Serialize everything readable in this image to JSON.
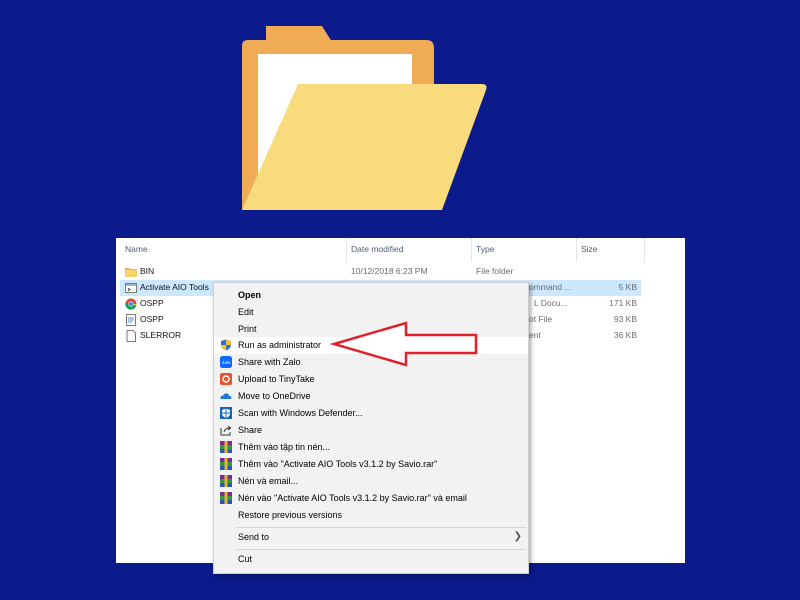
{
  "explorer": {
    "columns": {
      "name": "Name",
      "date": "Date modified",
      "type": "Type",
      "size": "Size"
    },
    "rows": [
      {
        "name": "BIN",
        "date": "10/12/2018 6:23 PM",
        "type": "File folder",
        "size": "",
        "icon": "folder-icon"
      },
      {
        "name": "Activate AIO Tools",
        "type_partial": "ommand ...",
        "size": "5 KB",
        "icon": "cmd-file-icon"
      },
      {
        "name": "OSPP",
        "type_partial": "L Docu...",
        "size": "171 KB",
        "icon": "chrome-icon"
      },
      {
        "name": "OSPP",
        "type_partial": "ot File",
        "size": "93 KB",
        "icon": "script-file-icon"
      },
      {
        "name": "SLERROR",
        "type_partial": "ent",
        "size": "36 KB",
        "icon": "document-icon"
      }
    ]
  },
  "context_menu": {
    "items": [
      {
        "label": "Open",
        "icon": ""
      },
      {
        "label": "Edit",
        "icon": ""
      },
      {
        "label": "Print",
        "icon": ""
      },
      {
        "label": "Run as administrator",
        "icon": "uac-shield-icon"
      },
      {
        "label": "Share with Zalo",
        "icon": "zalo-icon"
      },
      {
        "label": "Upload to TinyTake",
        "icon": "tinytake-icon"
      },
      {
        "label": "Move to OneDrive",
        "icon": "onedrive-icon"
      },
      {
        "label": "Scan with Windows Defender...",
        "icon": "defender-icon"
      },
      {
        "label": "Share",
        "icon": "share-icon"
      },
      {
        "label": "Thêm vào tập tin nén...",
        "icon": "winrar-icon"
      },
      {
        "label": "Thêm vào \"Activate AIO Tools v3.1.2 by Savio.rar\"",
        "icon": "winrar-icon"
      },
      {
        "label": "Nén và email...",
        "icon": "winrar-icon"
      },
      {
        "label": "Nén vào \"Activate AIO Tools v3.1.2 by Savio.rar\" và email",
        "icon": "winrar-icon"
      },
      {
        "label": "Restore previous versions",
        "icon": ""
      },
      {
        "label": "Send to",
        "icon": ""
      },
      {
        "label": "Cut",
        "icon": ""
      }
    ]
  },
  "colors": {
    "background": "#0c1b8c",
    "highlight_arrow": "#e0202a",
    "selection": "#cce8ff"
  }
}
